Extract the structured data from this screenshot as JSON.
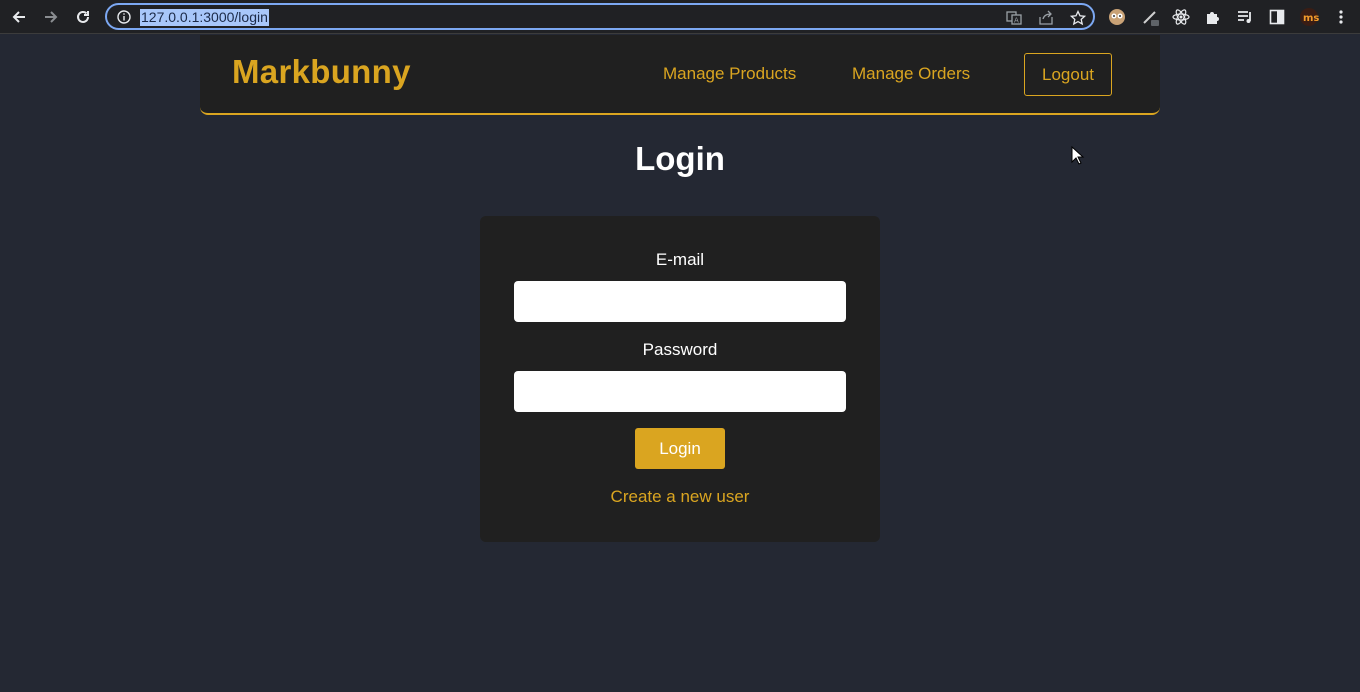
{
  "browser": {
    "url": "127.0.0.1:3000/login",
    "icons": [
      "back-arrow-icon",
      "forward-arrow-icon",
      "reload-icon",
      "info-icon",
      "translate-icon",
      "share-icon",
      "star-icon",
      "extension-owl-icon",
      "extension-pen-icon",
      "react-icon",
      "puzzle-icon",
      "playlist-icon",
      "sidepanel-icon",
      "extension-ms-icon",
      "kebab-menu-icon"
    ]
  },
  "header": {
    "brand": "Markbunny",
    "nav": [
      "Manage Products",
      "Manage Orders"
    ],
    "logout": "Logout"
  },
  "page": {
    "title": "Login"
  },
  "form": {
    "email_label": "E-mail",
    "email_value": "",
    "password_label": "Password",
    "password_value": "",
    "submit_label": "Login",
    "create_user_link": "Create a new user"
  },
  "colors": {
    "background": "#242833",
    "panel": "#202020",
    "accent": "#daa520"
  }
}
